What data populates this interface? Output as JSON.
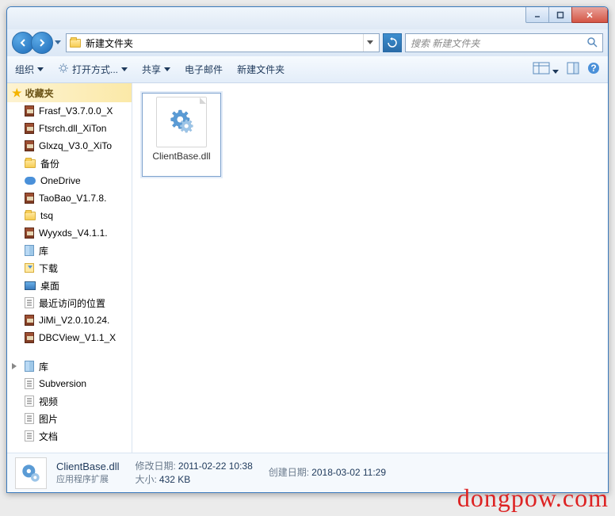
{
  "titlebar": {
    "min": "–",
    "max": "☐",
    "close": "✕"
  },
  "nav": {
    "breadcrumb_folder": "新建文件夹",
    "search_placeholder": "搜索 新建文件夹"
  },
  "toolbar": {
    "organize": "组织",
    "open_with": "打开方式...",
    "share": "共享",
    "email": "电子邮件",
    "new_folder": "新建文件夹"
  },
  "sidebar": {
    "favorites_label": "收藏夹",
    "items": [
      {
        "label": "Frasf_V3.7.0.0_X",
        "icon": "rar"
      },
      {
        "label": "Ftsrch.dll_XiTon",
        "icon": "rar"
      },
      {
        "label": "Glxzq_V3.0_XiTo",
        "icon": "rar"
      },
      {
        "label": "备份",
        "icon": "folder"
      },
      {
        "label": "OneDrive",
        "icon": "cloud"
      },
      {
        "label": "TaoBao_V1.7.8.",
        "icon": "rar"
      },
      {
        "label": "tsq",
        "icon": "folder"
      },
      {
        "label": "Wyyxds_V4.1.1.",
        "icon": "rar"
      },
      {
        "label": "库",
        "icon": "lib"
      },
      {
        "label": "下载",
        "icon": "download"
      },
      {
        "label": "桌面",
        "icon": "desktop"
      },
      {
        "label": "最近访问的位置",
        "icon": "generic"
      },
      {
        "label": "JiMi_V2.0.10.24.",
        "icon": "rar"
      },
      {
        "label": "DBCView_V1.1_X",
        "icon": "rar"
      }
    ],
    "section2": {
      "label": "库",
      "items": [
        {
          "label": "Subversion",
          "icon": "generic"
        },
        {
          "label": "视频",
          "icon": "generic"
        },
        {
          "label": "图片",
          "icon": "generic"
        },
        {
          "label": "文档",
          "icon": "generic"
        }
      ]
    }
  },
  "content": {
    "files": [
      {
        "name": "ClientBase.dll"
      }
    ]
  },
  "details": {
    "name": "ClientBase.dll",
    "type": "应用程序扩展",
    "mod_label": "修改日期:",
    "mod_value": "2011-02-22 10:38",
    "size_label": "大小:",
    "size_value": "432 KB",
    "create_label": "创建日期:",
    "create_value": "2018-03-02 11:29"
  },
  "watermark": "dongpow.com"
}
